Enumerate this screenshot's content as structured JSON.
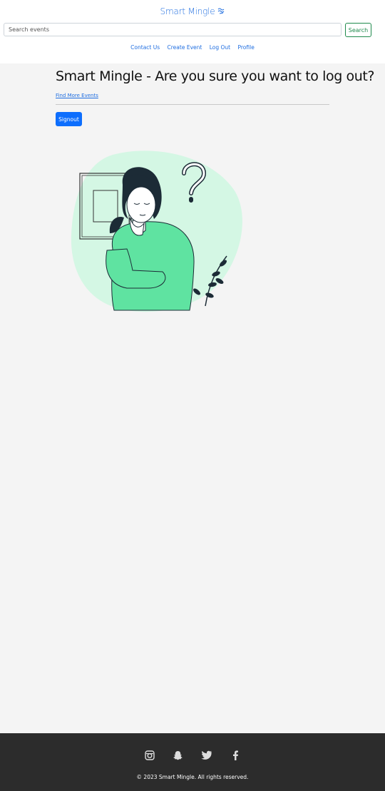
{
  "header": {
    "brand": "Smart Mingle",
    "brand_icon": "wave-icon",
    "search": {
      "placeholder": "Search events",
      "button_label": "Search"
    },
    "nav": [
      {
        "label": "Contact Us"
      },
      {
        "label": "Create Event"
      },
      {
        "label": "Log Out"
      },
      {
        "label": "Profile"
      }
    ]
  },
  "main": {
    "title": "Smart Mingle - Are you sure you want to log out?",
    "find_more_link": "Find More Events",
    "signout_button": "Signout",
    "illustration": "thinking-woman-illustration"
  },
  "footer": {
    "social_icons": [
      "instagram-icon",
      "snapchat-icon",
      "twitter-icon",
      "facebook-icon"
    ],
    "copyright": "© 2023 Smart Mingle. All rights reserved."
  },
  "colors": {
    "link": "#1e6de0",
    "primary_button": "#0d6efd",
    "search_button": "#1f8a4c",
    "illustration_green": "#5fe3a1",
    "illustration_bg": "#d4f7e4",
    "footer_bg": "#2c2c2c",
    "page_bg": "#f4f4f4"
  }
}
